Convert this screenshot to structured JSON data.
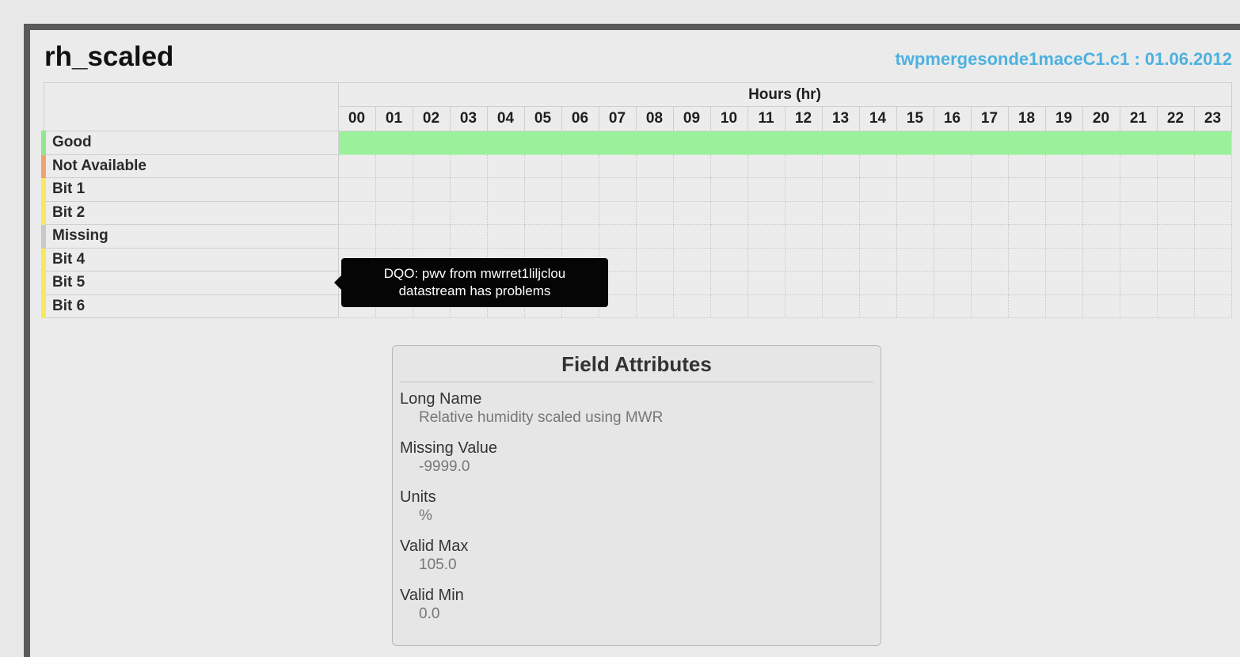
{
  "page": {
    "title": "rh_scaled",
    "source": "twpmergesonde1maceC1.c1 : 01.06.2012"
  },
  "grid": {
    "hours_title": "Hours (hr)",
    "hours": [
      "00",
      "01",
      "02",
      "03",
      "04",
      "05",
      "06",
      "07",
      "08",
      "09",
      "10",
      "11",
      "12",
      "13",
      "14",
      "15",
      "16",
      "17",
      "18",
      "19",
      "20",
      "21",
      "22",
      "23"
    ],
    "rows": [
      {
        "label": "Good",
        "color": "#8fe88f",
        "filled_hours": 24,
        "fill_color": "#9bf19b"
      },
      {
        "label": "Not Available",
        "color": "#f0a36b",
        "filled_hours": 0
      },
      {
        "label": "Bit 1",
        "color": "#f7ea5a",
        "filled_hours": 0
      },
      {
        "label": "Bit 2",
        "color": "#f7ea5a",
        "filled_hours": 0
      },
      {
        "label": "Missing",
        "color": "#c9c9c9",
        "filled_hours": 0
      },
      {
        "label": "Bit 4",
        "color": "#f7ea5a",
        "filled_hours": 0
      },
      {
        "label": "Bit 5",
        "color": "#f7ea5a",
        "filled_hours": 0
      },
      {
        "label": "Bit 6",
        "color": "#f7ea5a",
        "filled_hours": 0
      }
    ]
  },
  "tooltip": {
    "line1": "DQO: pwv from mwrret1liljclou",
    "line2": "datastream has problems"
  },
  "field_attributes": {
    "heading": "Field Attributes",
    "items": [
      {
        "key": "Long Name",
        "value": "Relative humidity scaled using MWR"
      },
      {
        "key": "Missing Value",
        "value": "-9999.0"
      },
      {
        "key": "Units",
        "value": "%"
      },
      {
        "key": "Valid Max",
        "value": "105.0"
      },
      {
        "key": "Valid Min",
        "value": "0.0"
      }
    ]
  },
  "colors": {
    "source_link": "#4db1e0",
    "frame": "#5a5a5a",
    "tooltip_bg": "#050505"
  }
}
